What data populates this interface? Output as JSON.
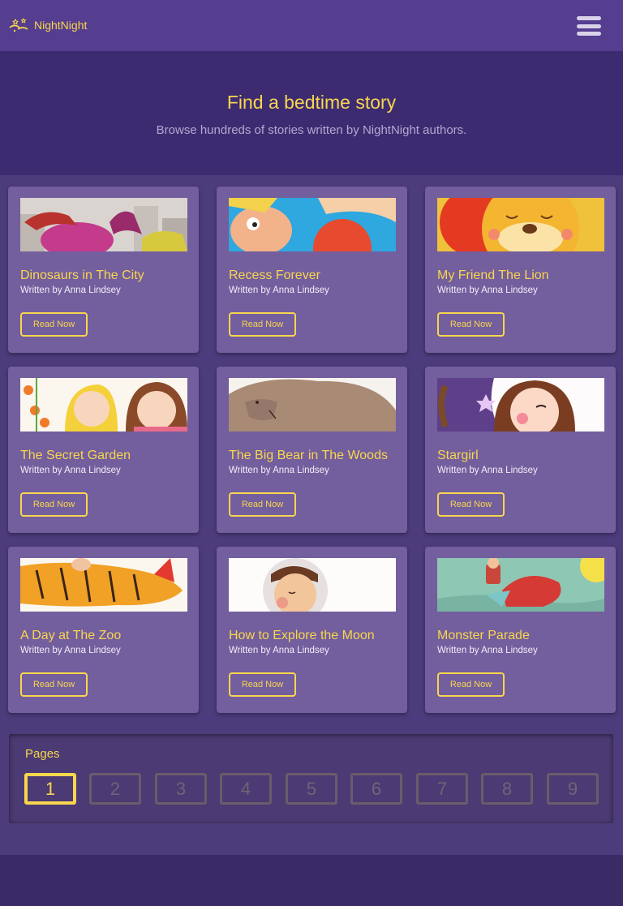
{
  "nav": {
    "brand": "NightNight",
    "logo_icon": "moon-stars-icon",
    "menu_icon": "hamburger-menu-icon"
  },
  "hero": {
    "title": "Find a bedtime story",
    "subtitle": "Browse hundreds of stories written by NightNight authors."
  },
  "stories": [
    {
      "title": "Dinosaurs in The City",
      "author": "Written by Anna Lindsey",
      "button": "Read Now"
    },
    {
      "title": "Recess Forever",
      "author": "Written by Anna Lindsey",
      "button": "Read Now"
    },
    {
      "title": "My Friend The Lion",
      "author": "Written by Anna Lindsey",
      "button": "Read Now"
    },
    {
      "title": "The Secret Garden",
      "author": "Written by Anna Lindsey",
      "button": "Read Now"
    },
    {
      "title": "The Big Bear in The Woods",
      "author": "Written by Anna Lindsey",
      "button": "Read Now"
    },
    {
      "title": "Stargirl",
      "author": "Written by Anna Lindsey",
      "button": "Read Now"
    },
    {
      "title": "A Day at The Zoo",
      "author": "Written by Anna Lindsey",
      "button": "Read Now"
    },
    {
      "title": "How to Explore the Moon",
      "author": "Written by Anna Lindsey",
      "button": "Read Now"
    },
    {
      "title": "Monster Parade",
      "author": "Written by Anna Lindsey",
      "button": "Read Now"
    }
  ],
  "pagination": {
    "label": "Pages",
    "pages": [
      "1",
      "2",
      "3",
      "4",
      "5",
      "6",
      "7",
      "8",
      "9"
    ],
    "current": "1"
  },
  "colors": {
    "accent": "#f8d64e",
    "navbar": "#553d8f",
    "card": "#735e9e",
    "background": "#3a2a66"
  }
}
